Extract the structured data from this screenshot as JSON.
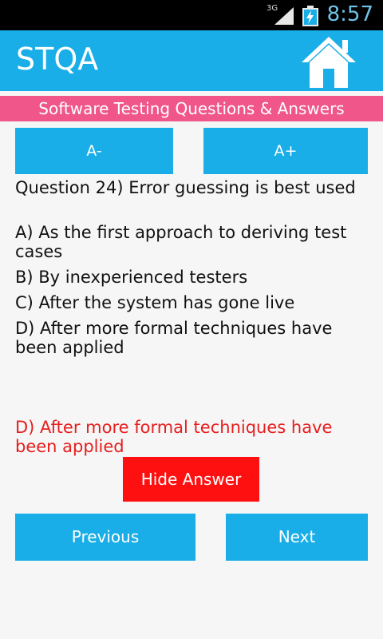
{
  "status_bar": {
    "network": "3G",
    "time": "8:57"
  },
  "app": {
    "title": "STQA",
    "home_icon": "home-icon",
    "subtitle": "Software Testing Questions & Answers"
  },
  "font_controls": {
    "decrease_label": "A-",
    "increase_label": "A+"
  },
  "question": {
    "text": "Question 24) Error guessing is best used",
    "options": [
      "A) As the first approach to deriving test cases",
      "B) By inexperienced testers",
      "C) After the system has gone live",
      "D) After more formal techniques have been applied"
    ],
    "answer": "D) After more formal techniques have been applied"
  },
  "buttons": {
    "hide_answer": "Hide Answer",
    "previous": "Previous",
    "next": "Next"
  },
  "colors": {
    "primary": "#19aee7",
    "accent": "#f0568a",
    "answer": "#e61e1e",
    "hide_button": "#ff1010"
  }
}
